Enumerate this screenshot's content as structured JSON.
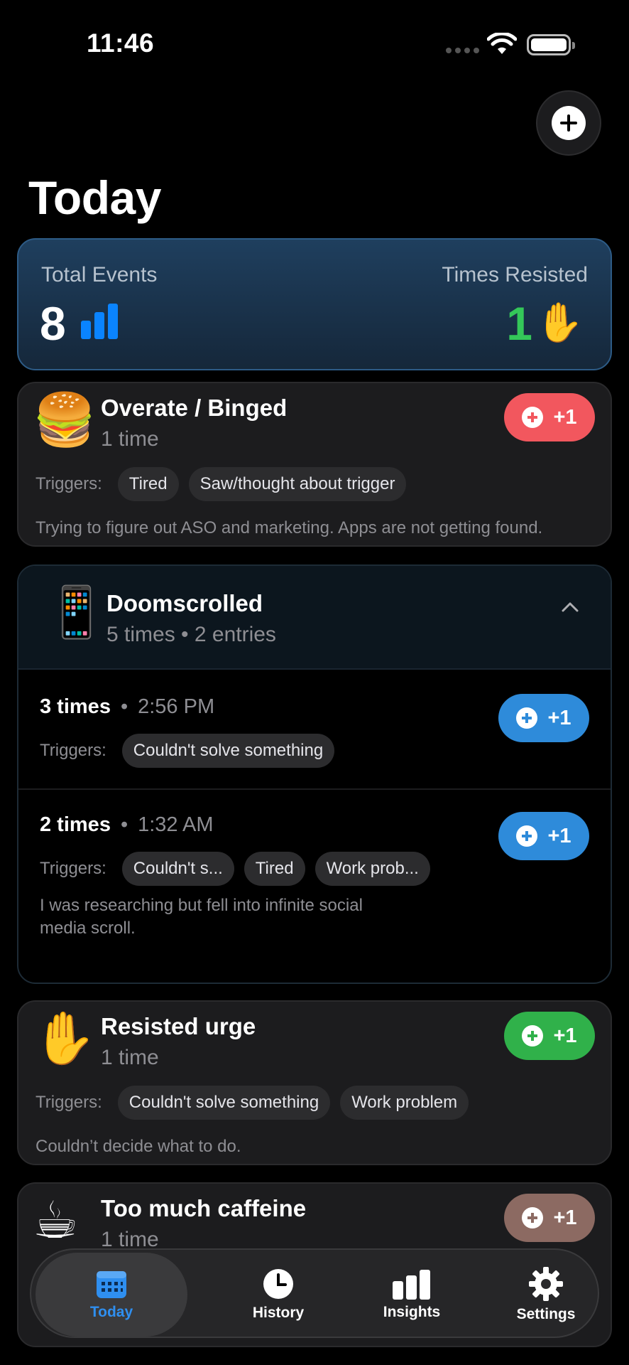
{
  "status_bar": {
    "time": "11:46"
  },
  "page": {
    "title": "Today"
  },
  "summary": {
    "total_label": "Total Events",
    "total_value": "8",
    "resisted_label": "Times Resisted",
    "resisted_value": "1",
    "resisted_emoji": "✋"
  },
  "add_button_label": "+1",
  "trigger_label": "Triggers:",
  "cards": [
    {
      "emoji": "🍔",
      "title": "Overate / Binged",
      "subtitle": "1 time",
      "accent": "#f2575e",
      "triggers": [
        "Tired",
        "Saw/thought about trigger"
      ],
      "note": "Trying to figure out ASO and marketing. Apps are not getting found."
    },
    {
      "emoji": "✋",
      "title": "Resisted urge",
      "subtitle": "1 time",
      "accent": "#30b14a",
      "triggers": [
        "Couldn't solve something",
        "Work problem"
      ],
      "note": "Couldn’t decide what to do."
    },
    {
      "emoji": "☕",
      "title": "Too much caffeine",
      "subtitle": "1 time",
      "accent": "#8c6a62"
    }
  ],
  "group": {
    "emoji": "📱",
    "title": "Doomscrolled",
    "subtitle": "5 times • 2 entries",
    "accent": "#2e8bda",
    "entries": [
      {
        "count": "3 times",
        "time": "2:56 PM",
        "triggers": [
          "Couldn't solve something"
        ]
      },
      {
        "count": "2 times",
        "time": "1:32 AM",
        "triggers": [
          "Couldn't s...",
          "Tired",
          "Work prob..."
        ],
        "note_line1": "I was researching but fell into infinite social",
        "note_line2": "media scroll."
      }
    ]
  },
  "tabs": [
    {
      "label": "Today",
      "icon": "calendar-icon",
      "active": true,
      "color": "#2f8ff0"
    },
    {
      "label": "History",
      "icon": "clock-icon",
      "active": false
    },
    {
      "label": "Insights",
      "icon": "bar-chart-icon",
      "active": false
    },
    {
      "label": "Settings",
      "icon": "gear-icon",
      "active": false
    }
  ]
}
